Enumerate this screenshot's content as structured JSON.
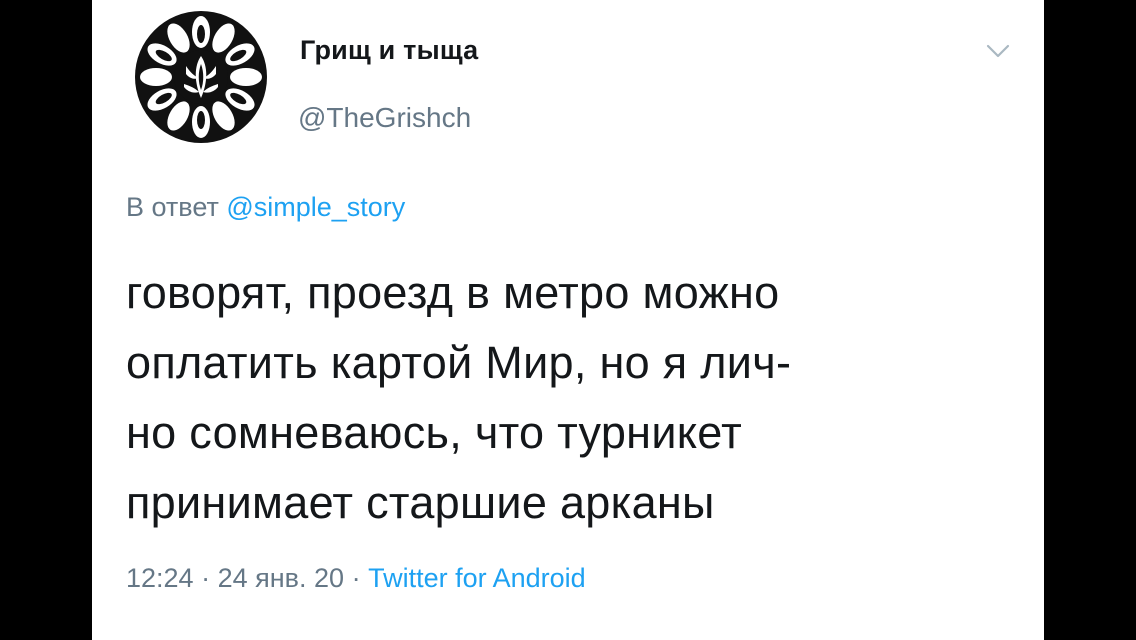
{
  "tweet": {
    "author": {
      "display_name": "Грищ и тыща",
      "handle": "@TheGrishch"
    },
    "reply": {
      "prefix": "В ответ",
      "mention": "@simple_story"
    },
    "text": "говорят, проезд в метро можно\nоплатить картой Мир, но я лич-\nно сомневаюсь, что турникет\nпринимает старшие арканы",
    "meta": {
      "time": "12:24",
      "separator": "·",
      "date": "24 янв. 20",
      "source": "Twitter for Android"
    }
  },
  "colors": {
    "background": "#000000",
    "card": "#ffffff",
    "text": "#14171a",
    "secondary": "#657786",
    "link": "#1da1f2"
  },
  "icons": {
    "avatar": "ornamental-circle-avatar",
    "menu": "chevron-down-icon"
  }
}
